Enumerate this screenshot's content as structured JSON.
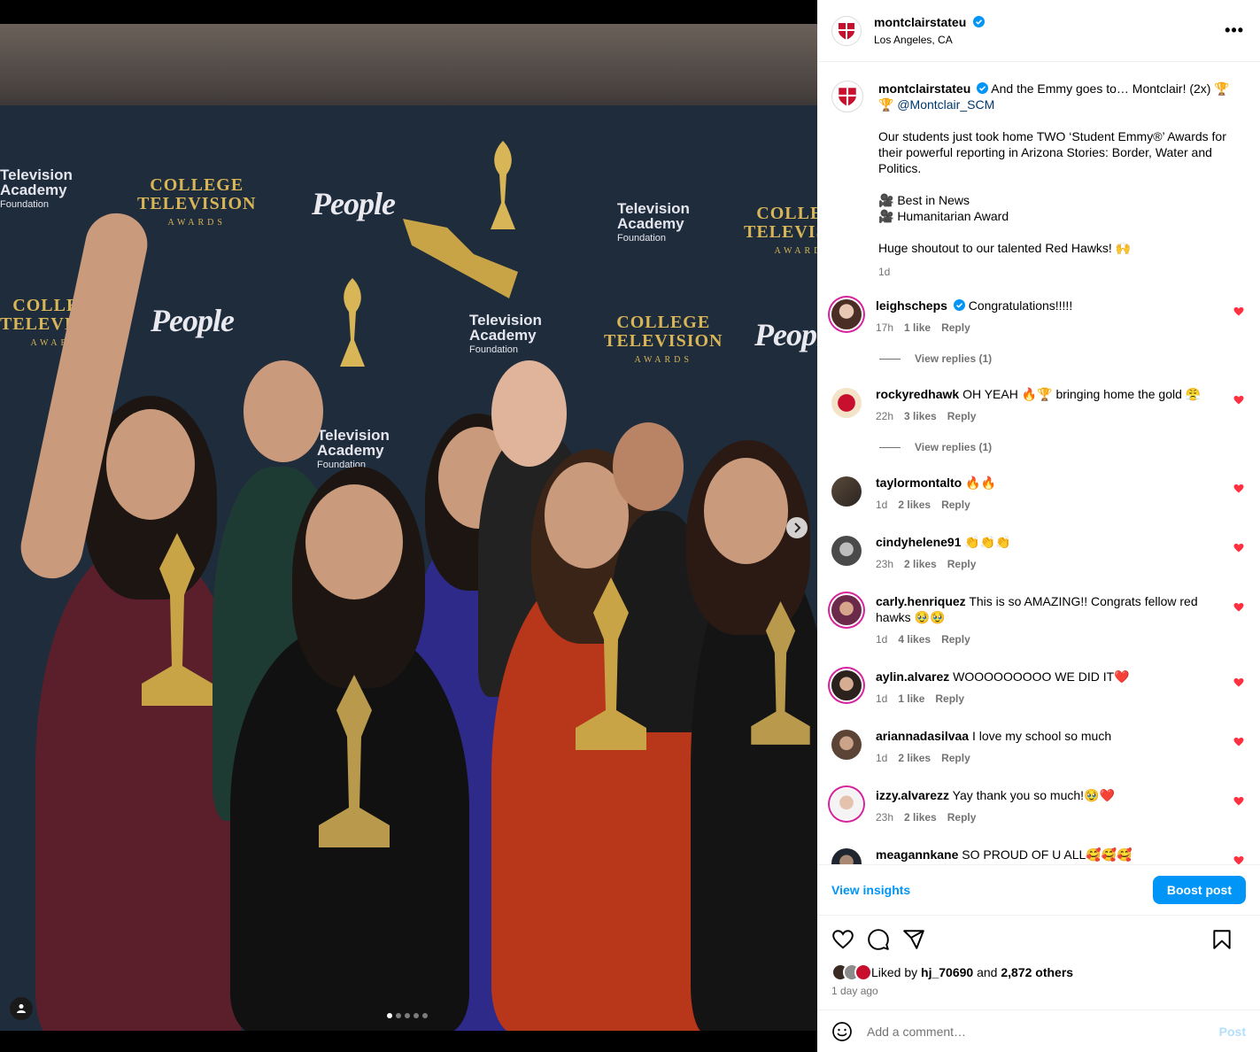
{
  "header": {
    "username": "montclairstateu",
    "location": "Los Angeles, CA",
    "more_label": "•••"
  },
  "backdrop_logos": {
    "college_tv_line1": "COLLEGE",
    "college_tv_line2": "TELEVISION",
    "college_tv_line3": "AWARDS",
    "people": "People",
    "ta_line1": "Television",
    "ta_line2": "Academy",
    "ta_line3": "Foundation"
  },
  "caption": {
    "username": "montclairstateu",
    "headline": "And the Emmy goes to… Montclair! (2x)",
    "trophy_emoji": "🏆",
    "mention": "@Montclair_SCM",
    "paragraph": "Our students just took home TWO ‘Student Emmy®’ Awards for their powerful reporting in Arizona Stories: Border, Water and Politics.",
    "award1": "🎥 Best in News",
    "award2": "🎥 Humanitarian Award",
    "shoutout": "Huge shoutout to our talented Red Hawks! 🙌",
    "time": "1d"
  },
  "comments": [
    {
      "username": "leighscheps",
      "text": "Congratulations!!!!!",
      "time": "17h",
      "likes": "1 like",
      "reply": "Reply",
      "view_replies": "View replies (1)"
    },
    {
      "username": "rockyredhawk",
      "text": "OH YEAH 🔥🏆 bringing home the gold 😤",
      "time": "22h",
      "likes": "3 likes",
      "reply": "Reply",
      "view_replies": "View replies (1)"
    },
    {
      "username": "taylormontalto",
      "text": "🔥🔥",
      "time": "1d",
      "likes": "2 likes",
      "reply": "Reply"
    },
    {
      "username": "cindyhelene91",
      "text": "👏👏👏",
      "time": "23h",
      "likes": "2 likes",
      "reply": "Reply"
    },
    {
      "username": "carly.henriquez",
      "text": "This is so AMAZING!! Congrats fellow red hawks 🥹🥹",
      "time": "1d",
      "likes": "4 likes",
      "reply": "Reply"
    },
    {
      "username": "aylin.alvarez",
      "text": "WOOOOOOOOO WE DID IT❤️",
      "time": "1d",
      "likes": "1 like",
      "reply": "Reply"
    },
    {
      "username": "ariannadasilvaa",
      "text": "I love my school so much",
      "time": "1d",
      "likes": "2 likes",
      "reply": "Reply"
    },
    {
      "username": "izzy.alvarezz",
      "text": "Yay thank you so much!🥹❤️",
      "time": "23h",
      "likes": "2 likes",
      "reply": "Reply"
    },
    {
      "username": "meagannkane",
      "text": "SO PROUD OF U ALL🥰🥰🥰",
      "time": "",
      "likes": "",
      "reply": ""
    }
  ],
  "insights": {
    "view_insights": "View insights",
    "boost_post": "Boost post"
  },
  "likes": {
    "prefix": "Liked by",
    "user": "hj_70690",
    "and": "and",
    "others": "2,872 others",
    "ago": "1 day ago"
  },
  "add_comment": {
    "placeholder": "Add a comment…",
    "post_label": "Post"
  },
  "colors": {
    "accent_blue": "#0095f6",
    "like_red": "#ff3040",
    "muted": "#737373"
  }
}
